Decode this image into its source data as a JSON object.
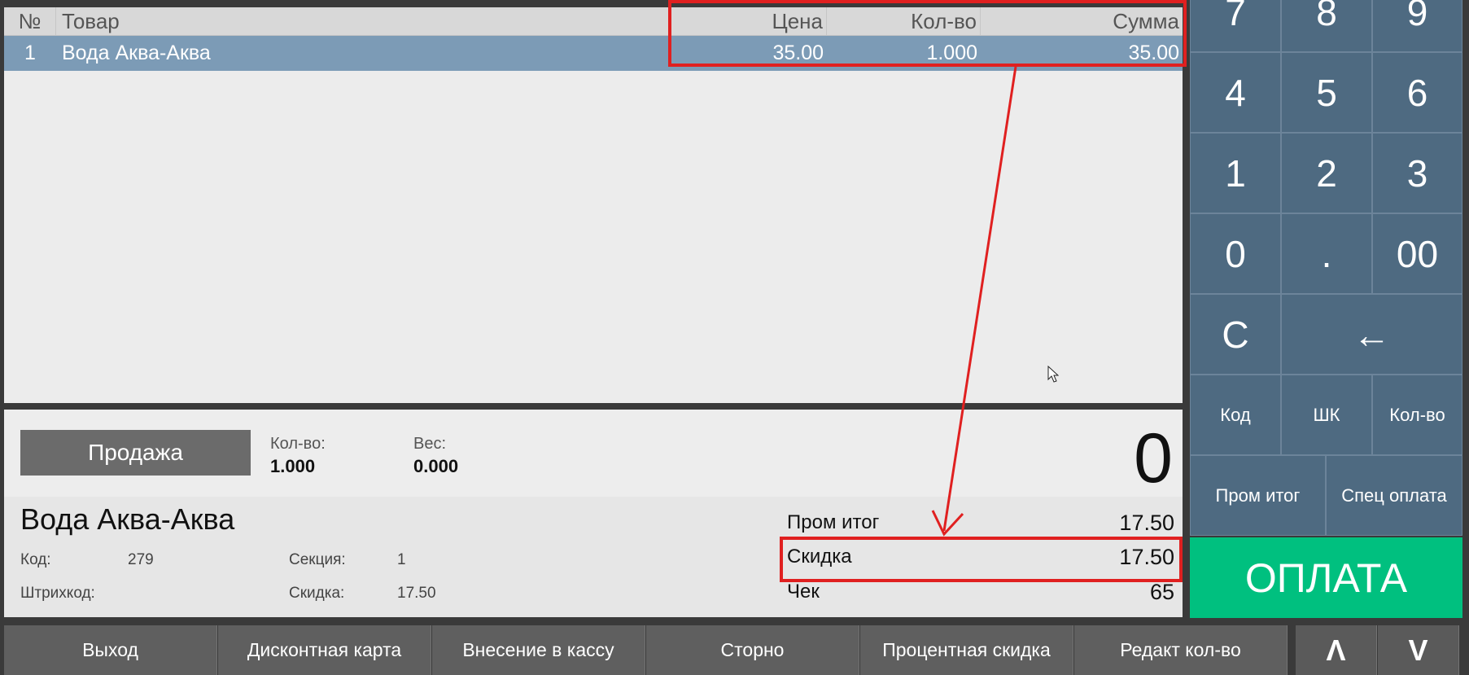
{
  "table": {
    "headers": {
      "no": "№",
      "name": "Товар",
      "price": "Цена",
      "qty": "Кол-во",
      "sum": "Сумма"
    },
    "rows": [
      {
        "no": "1",
        "name": "Вода Аква-Аква",
        "price": "35.00",
        "qty": "1.000",
        "sum": "35.00"
      }
    ]
  },
  "info": {
    "mode_label": "Продажа",
    "qty_label": "Кол-во:",
    "qty_value": "1.000",
    "weight_label": "Вес:",
    "weight_value": "0.000",
    "display_value": "0",
    "product_name": "Вода Аква-Аква",
    "code_label": "Код:",
    "code_value": "279",
    "section_label": "Секция:",
    "section_value": "1",
    "barcode_label": "Штрихкод:",
    "discount_label": "Скидка:",
    "discount_value": "17.50"
  },
  "totals": {
    "subtotal_label": "Пром итог",
    "subtotal_value": "17.50",
    "discount_label": "Скидка",
    "discount_value": "17.50",
    "receipt_label": "Чек",
    "receipt_value": "65"
  },
  "keypad": {
    "digits": [
      "7",
      "8",
      "9",
      "4",
      "5",
      "6",
      "1",
      "2",
      "3",
      "0",
      ".",
      "00"
    ],
    "clear": "C",
    "backspace": "←",
    "code": "Код",
    "barcode": "ШК",
    "quantity": "Кол-во",
    "subtotal": "Пром итог",
    "special_payment": "Спец оплата",
    "pay": "ОПЛАТА"
  },
  "bottom_bar": {
    "items": [
      "Выход",
      "Дисконтная карта",
      "Внесение в кассу",
      "Сторно",
      "Процентная скидка",
      "Редакт кол-во"
    ],
    "up": "Λ",
    "down": "V"
  },
  "colors": {
    "keypad": "#4e6a81",
    "selected_row": "#7c9bb6",
    "pay_button": "#00c07f",
    "annotation": "#e02020"
  }
}
